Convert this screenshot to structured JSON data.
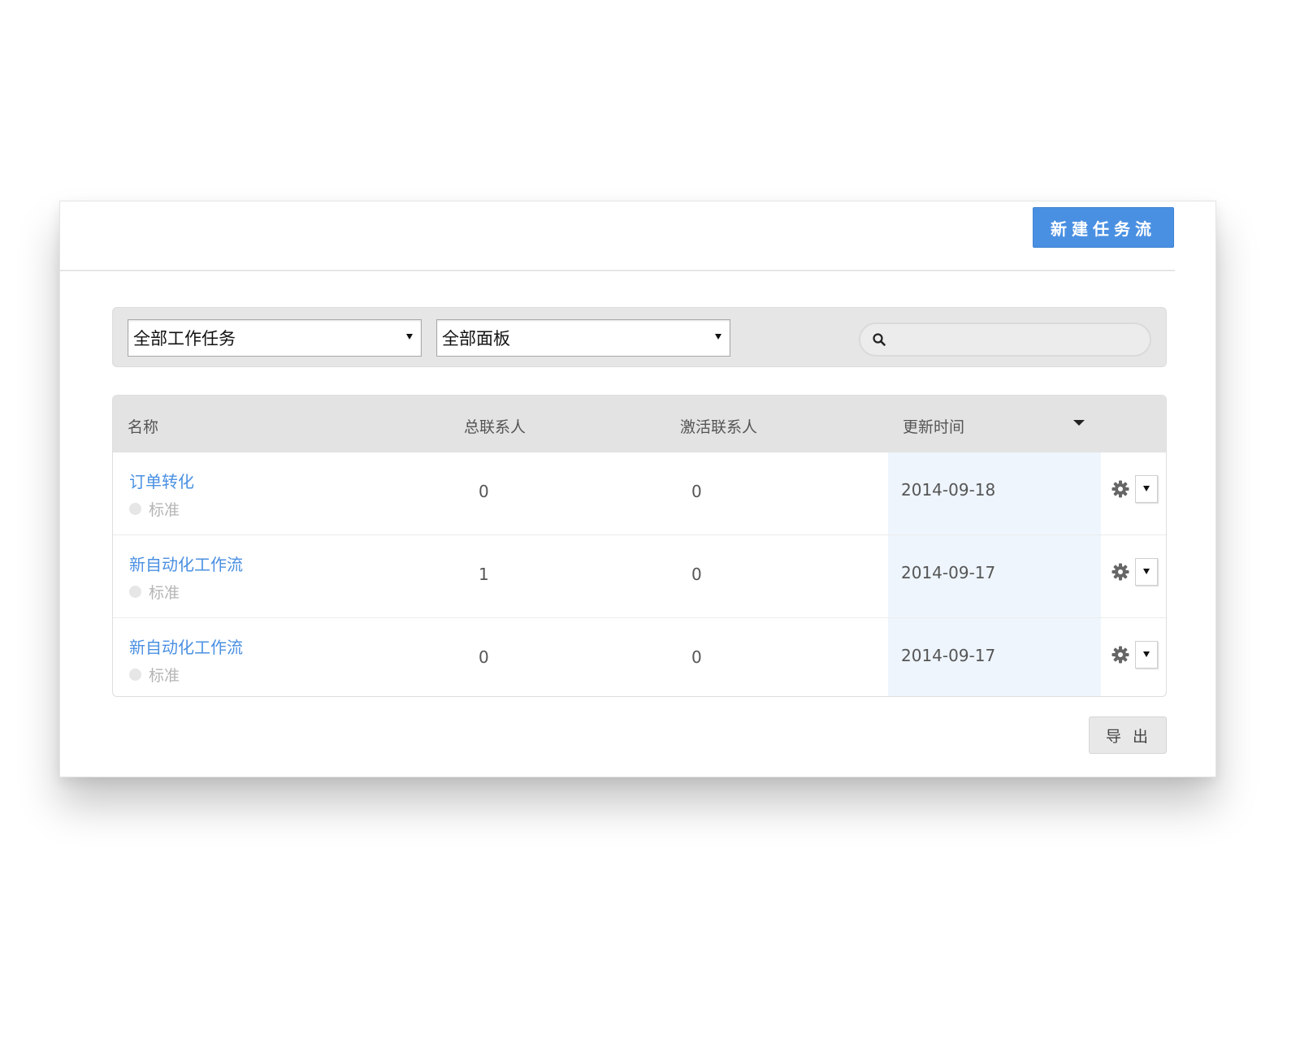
{
  "header": {
    "new_workflow_label": "新建任务流"
  },
  "filters": {
    "task_select_value": "全部工作任务",
    "status_select_value": "全部面板",
    "search_placeholder": ""
  },
  "table": {
    "columns": {
      "name": "名称",
      "total_contacts": "总联系人",
      "active_contacts": "激活联系人",
      "updated_time": "更新时间"
    },
    "rows": [
      {
        "name": "订单转化",
        "type": "标准",
        "total": "0",
        "active": "0",
        "date": "2014-09-18"
      },
      {
        "name": "新自动化工作流",
        "type": "标准",
        "total": "1",
        "active": "0",
        "date": "2014-09-17"
      },
      {
        "name": "新自动化工作流",
        "type": "标准",
        "total": "0",
        "active": "0",
        "date": "2014-09-17"
      }
    ]
  },
  "footer": {
    "export_label": "导出"
  },
  "colors": {
    "accent": "#4a90e2",
    "highlight_column": "#eef5fd",
    "header_bg": "#e3e3e3"
  },
  "icons": {
    "search": "search-icon",
    "gear": "gear-icon",
    "dropdown": "caret-down-icon"
  }
}
